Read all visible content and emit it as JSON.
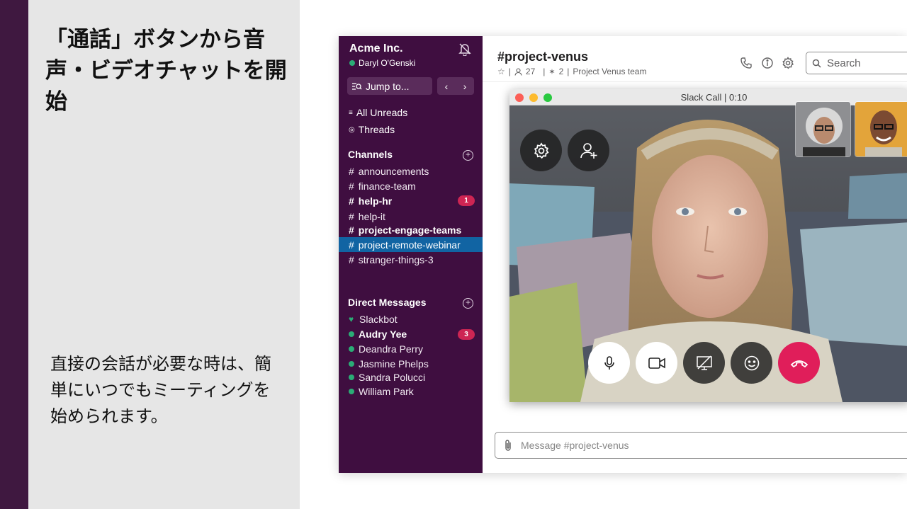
{
  "slide": {
    "title": "「通話」ボタンから音声・ビデオチャットを開始",
    "body": "直接の会話が必要な時は、簡単にいつでもミーティングを始められます。"
  },
  "workspace": {
    "name": "Acme Inc.",
    "user": "Daryl O'Genski",
    "jump_label": "Jump to..."
  },
  "nav": {
    "all_unreads": "All Unreads",
    "threads": "Threads"
  },
  "channels": {
    "heading": "Channels",
    "items": [
      {
        "name": "announcements",
        "bold": false,
        "active": false
      },
      {
        "name": "finance-team",
        "bold": false,
        "active": false
      },
      {
        "name": "help-hr",
        "bold": true,
        "active": false,
        "badge": "1"
      },
      {
        "name": "help-it",
        "bold": false,
        "active": false
      },
      {
        "name": "project-engage-teams",
        "bold": true,
        "active": false
      },
      {
        "name": "project-remote-webinar",
        "bold": false,
        "active": true
      },
      {
        "name": "stranger-things-3",
        "bold": false,
        "active": false
      }
    ]
  },
  "direct_messages": {
    "heading": "Direct Messages",
    "items": [
      {
        "name": "Slackbot",
        "bold": false
      },
      {
        "name": "Audry Yee",
        "bold": true,
        "badge": "3"
      },
      {
        "name": "Deandra Perry",
        "bold": false
      },
      {
        "name": "Jasmine Phelps",
        "bold": false
      },
      {
        "name": "Sandra Polucci",
        "bold": false
      },
      {
        "name": "William Park",
        "bold": false
      }
    ]
  },
  "channel_header": {
    "title": "#project-venus",
    "members": "27",
    "pinned": "2",
    "topic": "Project Venus team",
    "search_placeholder": "Search"
  },
  "call": {
    "title": "Slack Call | 0:10"
  },
  "composer": {
    "placeholder": "Message #project-venus"
  },
  "colors": {
    "sidebar": "#3f0e40",
    "active_channel": "#1164a3",
    "badge": "#cd2553",
    "presence": "#2bac76",
    "hangup": "#e01e5a",
    "accent_bar": "#3f1840"
  },
  "icons": [
    "bell-off-icon",
    "jump-icon",
    "chevron-left-icon",
    "chevron-right-icon",
    "star-icon",
    "member-icon",
    "pin-icon",
    "phone-icon",
    "info-icon",
    "gear-icon",
    "search-icon",
    "settings-icon",
    "add-person-icon",
    "mic-icon",
    "video-icon",
    "screen-share-off-icon",
    "emoji-icon",
    "hang-up-icon",
    "paperclip-icon"
  ]
}
